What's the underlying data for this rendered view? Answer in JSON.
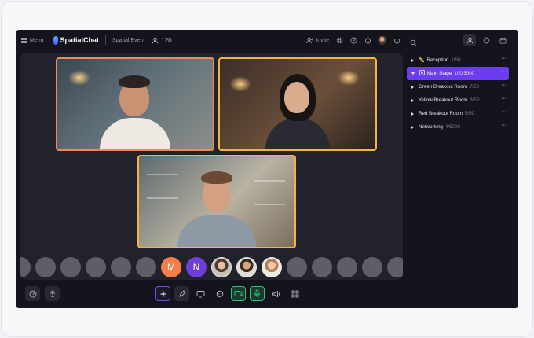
{
  "app": {
    "menu_label": "Menu",
    "brand": "SpatialChat",
    "event_name": "Spatial Event",
    "participant_count": "120",
    "invite_label": "Invite"
  },
  "stage": {
    "tiles": [
      {
        "border": "#f08a5a"
      },
      {
        "border": "#f2b640"
      },
      {
        "border": "#f2b640"
      }
    ]
  },
  "participants": {
    "initials": [
      "M",
      "N"
    ]
  },
  "rooms": [
    {
      "name": "Reception",
      "count": "1/50",
      "icon": "pencil-emoji-icon",
      "active": false
    },
    {
      "name": "Main Stage",
      "count": "100/5000",
      "icon": "stage-icon",
      "active": true
    },
    {
      "name": "Green Breakout Room",
      "count": "7/50",
      "active": false
    },
    {
      "name": "Yellow Breakout Room",
      "count": "3/50",
      "active": false
    },
    {
      "name": "Red Breakout Room",
      "count": "5/50",
      "active": false
    },
    {
      "name": "Networking",
      "count": "4/5000",
      "active": false
    }
  ],
  "colors": {
    "accent": "#6b3cf0",
    "mic_active": "#2fbf79",
    "bg": "#13141c"
  }
}
